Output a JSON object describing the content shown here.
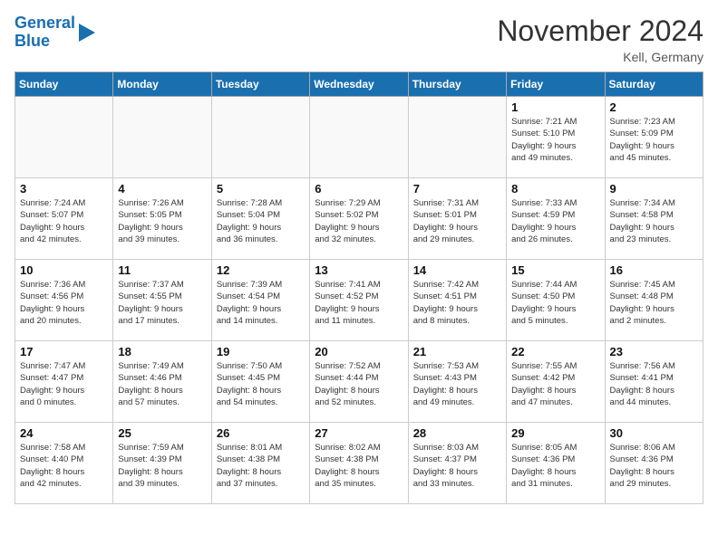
{
  "header": {
    "logo_line1": "General",
    "logo_line2": "Blue",
    "month": "November 2024",
    "location": "Kell, Germany"
  },
  "weekdays": [
    "Sunday",
    "Monday",
    "Tuesday",
    "Wednesday",
    "Thursday",
    "Friday",
    "Saturday"
  ],
  "weeks": [
    [
      {
        "day": "",
        "detail": ""
      },
      {
        "day": "",
        "detail": ""
      },
      {
        "day": "",
        "detail": ""
      },
      {
        "day": "",
        "detail": ""
      },
      {
        "day": "",
        "detail": ""
      },
      {
        "day": "1",
        "detail": "Sunrise: 7:21 AM\nSunset: 5:10 PM\nDaylight: 9 hours\nand 49 minutes."
      },
      {
        "day": "2",
        "detail": "Sunrise: 7:23 AM\nSunset: 5:09 PM\nDaylight: 9 hours\nand 45 minutes."
      }
    ],
    [
      {
        "day": "3",
        "detail": "Sunrise: 7:24 AM\nSunset: 5:07 PM\nDaylight: 9 hours\nand 42 minutes."
      },
      {
        "day": "4",
        "detail": "Sunrise: 7:26 AM\nSunset: 5:05 PM\nDaylight: 9 hours\nand 39 minutes."
      },
      {
        "day": "5",
        "detail": "Sunrise: 7:28 AM\nSunset: 5:04 PM\nDaylight: 9 hours\nand 36 minutes."
      },
      {
        "day": "6",
        "detail": "Sunrise: 7:29 AM\nSunset: 5:02 PM\nDaylight: 9 hours\nand 32 minutes."
      },
      {
        "day": "7",
        "detail": "Sunrise: 7:31 AM\nSunset: 5:01 PM\nDaylight: 9 hours\nand 29 minutes."
      },
      {
        "day": "8",
        "detail": "Sunrise: 7:33 AM\nSunset: 4:59 PM\nDaylight: 9 hours\nand 26 minutes."
      },
      {
        "day": "9",
        "detail": "Sunrise: 7:34 AM\nSunset: 4:58 PM\nDaylight: 9 hours\nand 23 minutes."
      }
    ],
    [
      {
        "day": "10",
        "detail": "Sunrise: 7:36 AM\nSunset: 4:56 PM\nDaylight: 9 hours\nand 20 minutes."
      },
      {
        "day": "11",
        "detail": "Sunrise: 7:37 AM\nSunset: 4:55 PM\nDaylight: 9 hours\nand 17 minutes."
      },
      {
        "day": "12",
        "detail": "Sunrise: 7:39 AM\nSunset: 4:54 PM\nDaylight: 9 hours\nand 14 minutes."
      },
      {
        "day": "13",
        "detail": "Sunrise: 7:41 AM\nSunset: 4:52 PM\nDaylight: 9 hours\nand 11 minutes."
      },
      {
        "day": "14",
        "detail": "Sunrise: 7:42 AM\nSunset: 4:51 PM\nDaylight: 9 hours\nand 8 minutes."
      },
      {
        "day": "15",
        "detail": "Sunrise: 7:44 AM\nSunset: 4:50 PM\nDaylight: 9 hours\nand 5 minutes."
      },
      {
        "day": "16",
        "detail": "Sunrise: 7:45 AM\nSunset: 4:48 PM\nDaylight: 9 hours\nand 2 minutes."
      }
    ],
    [
      {
        "day": "17",
        "detail": "Sunrise: 7:47 AM\nSunset: 4:47 PM\nDaylight: 9 hours\nand 0 minutes."
      },
      {
        "day": "18",
        "detail": "Sunrise: 7:49 AM\nSunset: 4:46 PM\nDaylight: 8 hours\nand 57 minutes."
      },
      {
        "day": "19",
        "detail": "Sunrise: 7:50 AM\nSunset: 4:45 PM\nDaylight: 8 hours\nand 54 minutes."
      },
      {
        "day": "20",
        "detail": "Sunrise: 7:52 AM\nSunset: 4:44 PM\nDaylight: 8 hours\nand 52 minutes."
      },
      {
        "day": "21",
        "detail": "Sunrise: 7:53 AM\nSunset: 4:43 PM\nDaylight: 8 hours\nand 49 minutes."
      },
      {
        "day": "22",
        "detail": "Sunrise: 7:55 AM\nSunset: 4:42 PM\nDaylight: 8 hours\nand 47 minutes."
      },
      {
        "day": "23",
        "detail": "Sunrise: 7:56 AM\nSunset: 4:41 PM\nDaylight: 8 hours\nand 44 minutes."
      }
    ],
    [
      {
        "day": "24",
        "detail": "Sunrise: 7:58 AM\nSunset: 4:40 PM\nDaylight: 8 hours\nand 42 minutes."
      },
      {
        "day": "25",
        "detail": "Sunrise: 7:59 AM\nSunset: 4:39 PM\nDaylight: 8 hours\nand 39 minutes."
      },
      {
        "day": "26",
        "detail": "Sunrise: 8:01 AM\nSunset: 4:38 PM\nDaylight: 8 hours\nand 37 minutes."
      },
      {
        "day": "27",
        "detail": "Sunrise: 8:02 AM\nSunset: 4:38 PM\nDaylight: 8 hours\nand 35 minutes."
      },
      {
        "day": "28",
        "detail": "Sunrise: 8:03 AM\nSunset: 4:37 PM\nDaylight: 8 hours\nand 33 minutes."
      },
      {
        "day": "29",
        "detail": "Sunrise: 8:05 AM\nSunset: 4:36 PM\nDaylight: 8 hours\nand 31 minutes."
      },
      {
        "day": "30",
        "detail": "Sunrise: 8:06 AM\nSunset: 4:36 PM\nDaylight: 8 hours\nand 29 minutes."
      }
    ]
  ]
}
